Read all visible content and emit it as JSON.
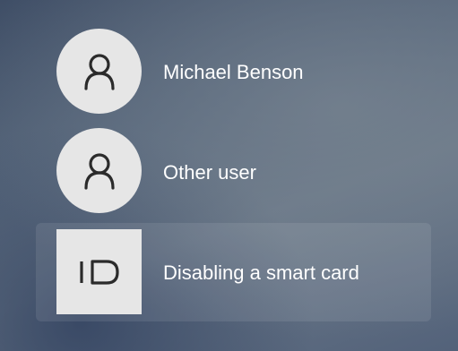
{
  "login_screen": {
    "users": [
      {
        "name": "Michael Benson",
        "icon": "person-icon"
      },
      {
        "name": "Other user",
        "icon": "person-icon"
      },
      {
        "name": "Disabling a smart card",
        "icon": "smart-card-id-icon",
        "selected": true
      }
    ]
  },
  "colors": {
    "tile_background": "#e6e6e6",
    "icon_stroke": "#2b2b2b",
    "text": "#ffffff"
  }
}
